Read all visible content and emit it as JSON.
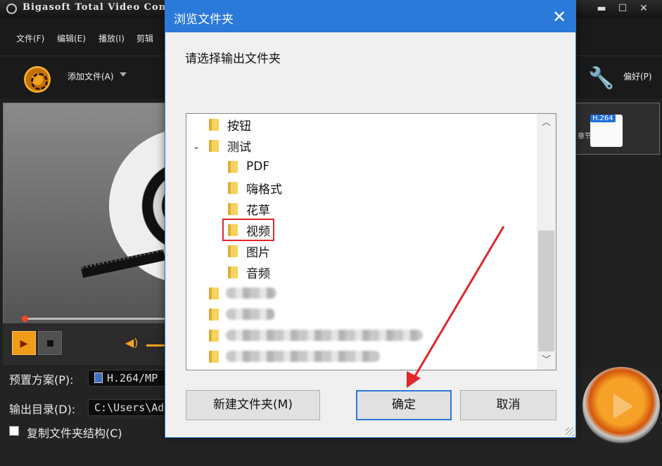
{
  "app": {
    "title": "Bigasoft Total Video Conv",
    "window_controls": [
      "▬",
      "☐",
      "✕"
    ],
    "menu": [
      "文件(F)",
      "编辑(E)",
      "播放(I)",
      "剪辑"
    ],
    "toolbar": {
      "add_file": "添加文件(A)",
      "preferences": "偏好(P)"
    },
    "right_thumb": {
      "badge": "H.264",
      "label": "章节"
    },
    "bottom": {
      "preset_label": "预置方案(P):",
      "preset_value": "H.264/MP",
      "output_label": "输出目录(D):",
      "output_value": "C:\\Users\\Adi",
      "copy_structure_label": "复制文件夹结构(C)"
    }
  },
  "dialog": {
    "title": "浏览文件夹",
    "close_glyph": "✕",
    "prompt": "请选择输出文件夹",
    "tree": [
      {
        "label": "按钮"
      },
      {
        "label": "测试",
        "expanded": true
      },
      {
        "label": "PDF"
      },
      {
        "label": "嗨格式"
      },
      {
        "label": "花草"
      },
      {
        "label": "视频",
        "highlighted": true
      },
      {
        "label": "图片"
      },
      {
        "label": "音频"
      }
    ],
    "buttons": {
      "new_folder": "新建文件夹(M)",
      "ok": "确定",
      "cancel": "取消"
    }
  },
  "colors": {
    "accent": "#2b79d8",
    "highlight": "#e0262b",
    "app_orange": "#f5a120"
  }
}
